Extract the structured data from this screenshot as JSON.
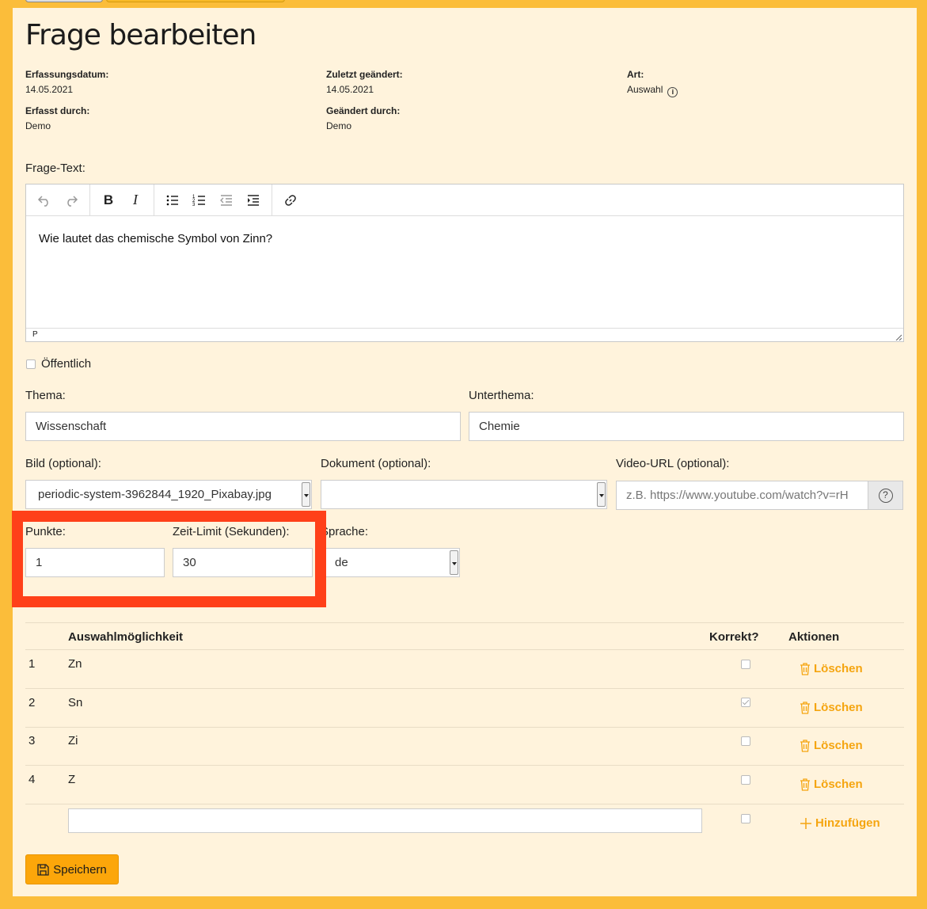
{
  "page": {
    "title": "Frage bearbeiten"
  },
  "meta": {
    "created_label": "Erfassungsdatum:",
    "created_value": "14.05.2021",
    "changed_label": "Zuletzt geändert:",
    "changed_value": "14.05.2021",
    "type_label": "Art:",
    "type_value": "Auswahl",
    "created_by_label": "Erfasst durch:",
    "created_by_value": "Demo",
    "changed_by_label": "Geändert durch:",
    "changed_by_value": "Demo"
  },
  "editor": {
    "label": "Frage-Text:",
    "content": "Wie lautet das chemische Symbol von Zinn?",
    "status_path": "P",
    "toolbar": [
      "undo-icon",
      "redo-icon",
      "bold-icon",
      "italic-icon",
      "bullet-list-icon",
      "numbered-list-icon",
      "outdent-icon",
      "indent-icon",
      "link-icon"
    ]
  },
  "public": {
    "label": "Öffentlich",
    "checked": false
  },
  "form": {
    "topic_label": "Thema:",
    "topic_value": "Wissenschaft",
    "subtopic_label": "Unterthema:",
    "subtopic_value": "Chemie",
    "image_label": "Bild (optional):",
    "image_value": "periodic-system-3962844_1920_Pixabay.jpg",
    "document_label": "Dokument (optional):",
    "document_value": "",
    "video_label": "Video-URL (optional):",
    "video_placeholder": "z.B. https://www.youtube.com/watch?v=rH",
    "points_label": "Punkte:",
    "points_value": "1",
    "timelimit_label": "Zeit-Limit (Sekunden):",
    "timelimit_value": "30",
    "language_label": "Sprache:",
    "language_value": "de"
  },
  "options_table": {
    "col_option": "Auswahlmöglichkeit",
    "col_correct": "Korrekt?",
    "col_actions": "Aktionen",
    "rows": [
      {
        "num": "1",
        "text": "Zn",
        "correct": false,
        "action": "Löschen"
      },
      {
        "num": "2",
        "text": "Sn",
        "correct": true,
        "action": "Löschen"
      },
      {
        "num": "3",
        "text": "Zi",
        "correct": false,
        "action": "Löschen"
      },
      {
        "num": "4",
        "text": "Z",
        "correct": false,
        "action": "Löschen"
      }
    ],
    "add_label": "Hinzufügen",
    "new_option_value": ""
  },
  "save": {
    "label": "Speichern"
  },
  "colors": {
    "background": "#fbbd3a",
    "panel": "#fff3dc",
    "accent": "#f5a510",
    "highlight": "#ff4019"
  }
}
